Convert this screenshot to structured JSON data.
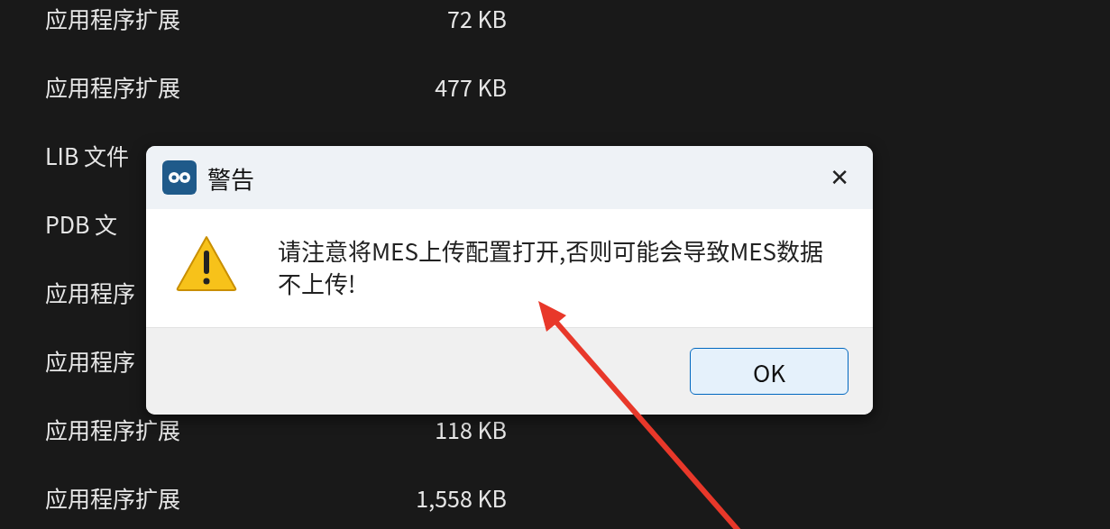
{
  "file_list": {
    "rows": [
      {
        "type": "应用程序扩展",
        "size": "72 KB"
      },
      {
        "type": "应用程序扩展",
        "size": "477 KB"
      },
      {
        "type": "LIB 文件"
      },
      {
        "type": "PDB 文"
      },
      {
        "type": "应用程序"
      },
      {
        "type": "应用程序"
      },
      {
        "type": "应用程序扩展",
        "size": "118 KB"
      },
      {
        "type": "应用程序扩展",
        "size": "1,558 KB"
      }
    ]
  },
  "dialog": {
    "title": "警告",
    "close": "✕",
    "message": "请注意将MES上传配置打开,否则可能会导致MES数据不上传!",
    "buttons": [
      "OK"
    ]
  },
  "annotations": [
    {
      "kind": "arrow"
    }
  ]
}
